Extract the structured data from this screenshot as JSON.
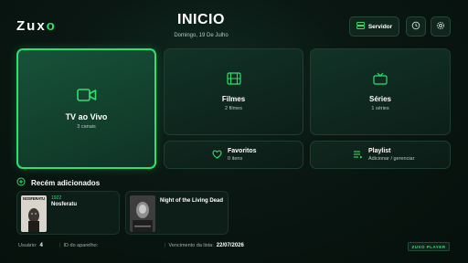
{
  "app": {
    "logo_text": "Zux",
    "logo_accent": "o",
    "title": "INICIO",
    "date": "Domingo, 19 De Julho",
    "accent_color": "#2ee06e"
  },
  "header": {
    "server_label": "Servidor",
    "server_icon": "server-icon",
    "history_icon": "history-icon",
    "settings_icon": "gear-icon"
  },
  "cards": {
    "live": {
      "title": "TV ao Vivo",
      "subtitle": "3 canais",
      "icon": "video-icon"
    },
    "movies": {
      "title": "Filmes",
      "subtitle": "2 filmes",
      "icon": "film-icon"
    },
    "series": {
      "title": "Séries",
      "subtitle": "1 séries",
      "icon": "tv-icon"
    },
    "favorites": {
      "title": "Favoritos",
      "subtitle": "0 itens",
      "icon": "heart-icon"
    },
    "playlist": {
      "title": "Playlist",
      "subtitle": "Adicionar / gerenciar",
      "icon": "playlist-icon"
    }
  },
  "recent": {
    "section_title": "Recém adicionados",
    "items": [
      {
        "year": "1922",
        "name": "Nosferatu",
        "poster_text": "NOSFERATU"
      },
      {
        "year": "",
        "name": "Night of the Living Dead",
        "poster_text": ""
      }
    ]
  },
  "footer": {
    "user_label": "Usuário:",
    "user_value": "4",
    "device_label": "ID do aparelho:",
    "expiry_label": "Vencimento da lista:",
    "expiry_value": "22/07/2026",
    "badge": "ZUXO PLAYER"
  }
}
